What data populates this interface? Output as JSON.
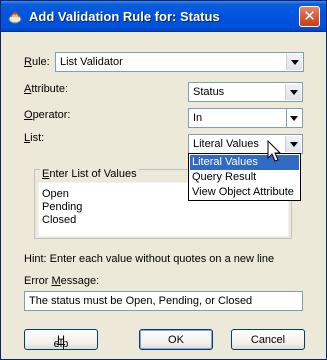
{
  "window": {
    "title": "Add Validation Rule for: Status"
  },
  "rule": {
    "label_u": "R",
    "label_rest": "ule:",
    "value": "List Validator"
  },
  "attribute": {
    "label_u": "A",
    "label_rest": "ttribute:",
    "value": "Status"
  },
  "operator": {
    "label_u": "O",
    "label_rest": "perator:",
    "value": "In"
  },
  "list": {
    "label_u": "L",
    "label_rest": "ist:",
    "value": "Literal Values",
    "options": [
      "Literal Values",
      "Query Result",
      "View Object Attribute"
    ],
    "selected_index": 0
  },
  "values_group": {
    "title_u": "E",
    "title_rest": "nter List of Values",
    "values": [
      "Open",
      "Pending",
      "Closed"
    ]
  },
  "hint": "Hint: Enter each value without quotes on a new line",
  "error_message": {
    "label_pre": "Error ",
    "label_u": "M",
    "label_rest": "essage:",
    "value": "The status must be Open, Pending, or Closed"
  },
  "buttons": {
    "help_u": "H",
    "help_rest": "elp",
    "ok": "OK",
    "cancel": "Cancel"
  },
  "colors": {
    "titlebar": "#0053e1",
    "selection": "#316ac5",
    "dialog_bg": "#ece9d8"
  }
}
